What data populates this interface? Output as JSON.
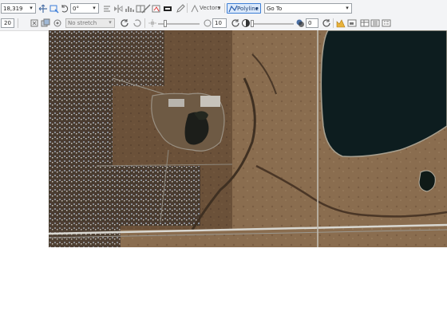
{
  "toolbar_top": {
    "scale_value": "18,319",
    "rotation_value": "0°",
    "vectors_label": "Vectors",
    "polyline_label": "Polyline",
    "goto_label": "Go To"
  },
  "toolbar_bottom": {
    "zoom_value": "20",
    "stretch_value": "No stretch",
    "brightness_value": "10",
    "transparency_value": "0"
  },
  "image": {
    "description_icon": "satellite-image-icon"
  },
  "colors": {
    "accent": "#3d7fd6",
    "toolbar_bg": "#f3f4f6"
  }
}
